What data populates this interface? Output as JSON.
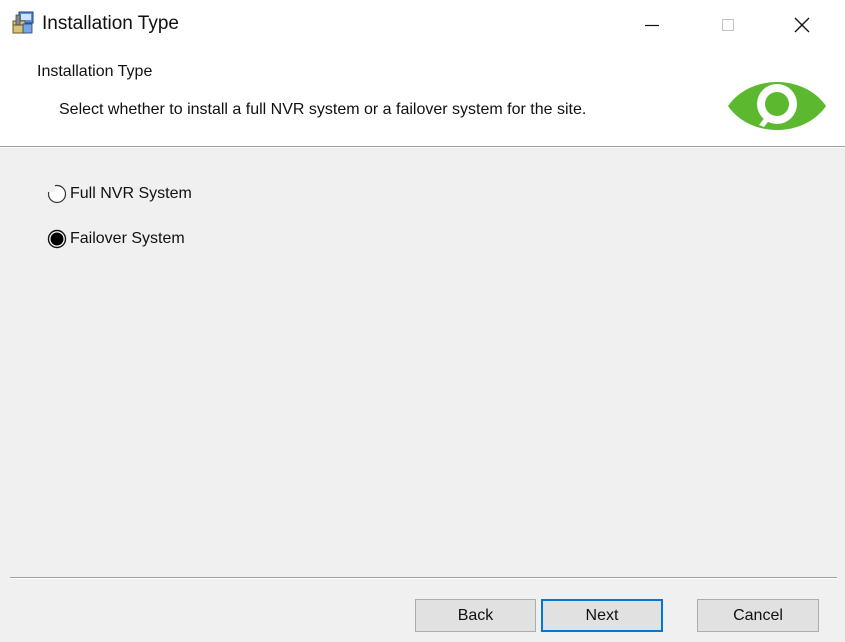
{
  "window": {
    "title": "Installation Type",
    "icon": "installer-package-icon",
    "controls": {
      "minimize_icon": "minimize-icon",
      "maximize_icon": "maximize-icon",
      "close_icon": "close-icon"
    }
  },
  "header": {
    "title": "Installation Type",
    "description": "Select whether to install a full NVR system or a failover system for the site.",
    "logo_icon": "eye-logo-icon",
    "logo_color": "#5cb82e"
  },
  "options": [
    {
      "label": "Full NVR System",
      "selected": false
    },
    {
      "label": "Failover System",
      "selected": true
    }
  ],
  "buttons": {
    "back": "Back",
    "next": "Next",
    "cancel": "Cancel"
  },
  "colors": {
    "content_background": "#f0f0f0",
    "focus_border": "#0078d7"
  }
}
